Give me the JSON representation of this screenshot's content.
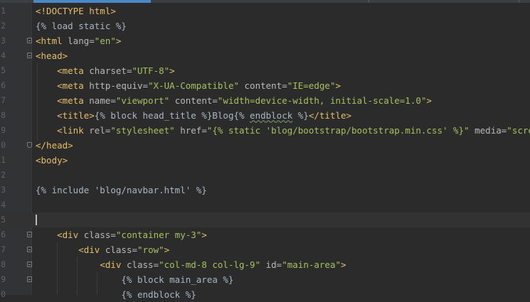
{
  "editor": {
    "line_numbers": [
      "1",
      "2",
      "3",
      "4",
      "5",
      "6",
      "7",
      "8",
      "9",
      "0",
      "1",
      "2",
      "3",
      "4",
      "5",
      "6",
      "7",
      "8",
      "9",
      "0"
    ],
    "lines": [
      [
        {
          "c": "t",
          "v": "<!DOCTYPE html>"
        }
      ],
      [
        {
          "c": "d",
          "v": "{% load static %}"
        }
      ],
      [
        {
          "c": "t",
          "v": "<html "
        },
        {
          "c": "a",
          "v": "lang="
        },
        {
          "c": "s",
          "v": "\"en\""
        },
        {
          "c": "t",
          "v": ">"
        }
      ],
      [
        {
          "c": "t",
          "v": "<head>"
        }
      ],
      [
        {
          "c": "d",
          "v": "    "
        },
        {
          "c": "t",
          "v": "<meta "
        },
        {
          "c": "a",
          "v": "charset="
        },
        {
          "c": "s",
          "v": "\"UTF-8\""
        },
        {
          "c": "t",
          "v": ">"
        }
      ],
      [
        {
          "c": "d",
          "v": "    "
        },
        {
          "c": "t",
          "v": "<meta "
        },
        {
          "c": "a",
          "v": "http-equiv="
        },
        {
          "c": "s",
          "v": "\"X-UA-Compatible\""
        },
        {
          "c": "a",
          "v": " content="
        },
        {
          "c": "s",
          "v": "\"IE=edge\""
        },
        {
          "c": "t",
          "v": ">"
        }
      ],
      [
        {
          "c": "d",
          "v": "    "
        },
        {
          "c": "t",
          "v": "<meta "
        },
        {
          "c": "a",
          "v": "name="
        },
        {
          "c": "s",
          "v": "\"viewport\""
        },
        {
          "c": "a",
          "v": " content="
        },
        {
          "c": "s",
          "v": "\"width=device-width, initial-scale=1.0\""
        },
        {
          "c": "t",
          "v": ">"
        }
      ],
      [
        {
          "c": "d",
          "v": "    "
        },
        {
          "c": "t",
          "v": "<title>"
        },
        {
          "c": "d",
          "v": "{% block head_title %}Blog{% "
        },
        {
          "c": "w",
          "v": "endblock"
        },
        {
          "c": "d",
          "v": " %}"
        },
        {
          "c": "t",
          "v": "</title>"
        }
      ],
      [
        {
          "c": "d",
          "v": "    "
        },
        {
          "c": "t",
          "v": "<link "
        },
        {
          "c": "a",
          "v": "rel="
        },
        {
          "c": "s",
          "v": "\"stylesheet\""
        },
        {
          "c": "a",
          "v": " href="
        },
        {
          "c": "s",
          "v": "\"{% static 'blog/bootstrap/bootstrap.min.css' %}\""
        },
        {
          "c": "a",
          "v": " media="
        },
        {
          "c": "s",
          "v": "\"screen\""
        },
        {
          "c": "t",
          "v": ">"
        }
      ],
      [
        {
          "c": "t",
          "v": "</head>"
        }
      ],
      [
        {
          "c": "t",
          "v": "<body>"
        }
      ],
      [],
      [
        {
          "c": "d",
          "v": "{% include 'blog/navbar.html' %}"
        }
      ],
      [],
      [],
      [
        {
          "c": "d",
          "v": "    "
        },
        {
          "c": "t",
          "v": "<div "
        },
        {
          "c": "a",
          "v": "class="
        },
        {
          "c": "s",
          "v": "\"container my-3\""
        },
        {
          "c": "t",
          "v": ">"
        }
      ],
      [
        {
          "c": "d",
          "v": "        "
        },
        {
          "c": "t",
          "v": "<div "
        },
        {
          "c": "a",
          "v": "class="
        },
        {
          "c": "s",
          "v": "\"row\""
        },
        {
          "c": "t",
          "v": ">"
        }
      ],
      [
        {
          "c": "d",
          "v": "            "
        },
        {
          "c": "t",
          "v": "<div "
        },
        {
          "c": "a",
          "v": "class="
        },
        {
          "c": "s",
          "v": "\"col-md-8 col-lg-9\""
        },
        {
          "c": "a",
          "v": " id="
        },
        {
          "c": "s",
          "v": "\"main-area\""
        },
        {
          "c": "t",
          "v": ">"
        }
      ],
      [
        {
          "c": "d",
          "v": "                {% block main_area %}"
        }
      ],
      [
        {
          "c": "d",
          "v": "                {% endblock %}"
        }
      ]
    ]
  }
}
